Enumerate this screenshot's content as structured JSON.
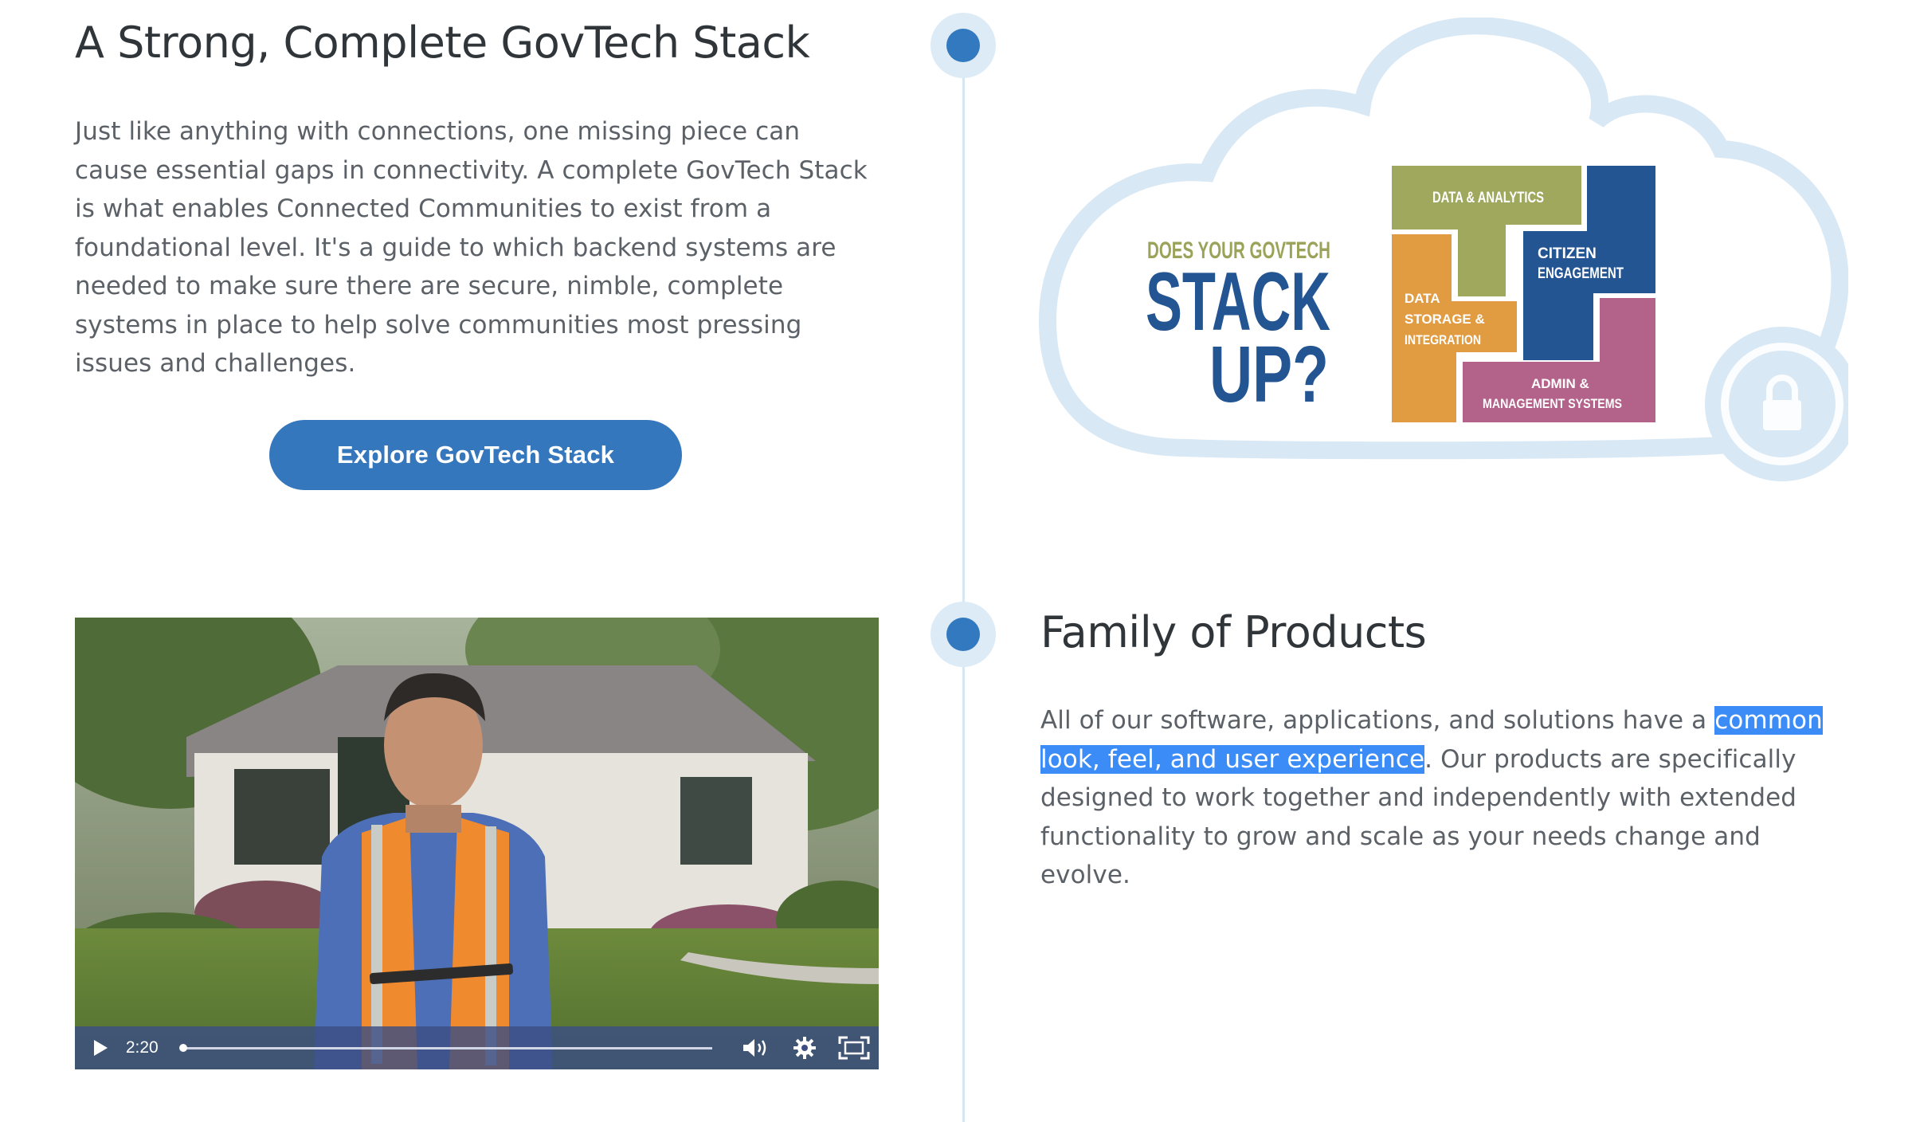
{
  "section1": {
    "title": "A Strong, Complete GovTech Stack",
    "body": "Just like anything with connections, one missing piece can cause essential gaps in connectivity. A complete GovTech Stack is what enables Connected Communities to exist from a foundational level. It's a guide to which backend systems are needed to make sure there are secure, nimble, complete systems in place to help solve communities most pressing issues and challenges.",
    "button_label": "Explore GovTech Stack"
  },
  "section2": {
    "title": "Family of Products",
    "body_before": "All of our software, applications, and solutions have a ",
    "body_highlight": "common look, feel, and user experience",
    "body_after": ". Our products are specifically designed to work together and independently with extended functionality to grow and scale as your needs change and evolve."
  },
  "video": {
    "time": "2:20",
    "progress": 0.0
  },
  "graphic": {
    "tagline": "DOES YOUR GOVTECH",
    "headline_1": "STACK",
    "headline_2": "UP?",
    "blocks": {
      "data_analytics": "DATA & ANALYTICS",
      "citizen_1": "CITIZEN",
      "citizen_2": "ENGAGEMENT",
      "storage_1": "DATA",
      "storage_2": "STORAGE &",
      "storage_3": "INTEGRATION",
      "admin_1": "ADMIN &",
      "admin_2": "MANAGEMENT SYSTEMS"
    }
  },
  "colors": {
    "accent": "#3577bd",
    "highlight": "#3b8cf7",
    "timeline": "#d6e7f3",
    "olive": "#a0a85e",
    "navy": "#245593",
    "orange": "#e19b40",
    "magenta": "#b3628a"
  }
}
